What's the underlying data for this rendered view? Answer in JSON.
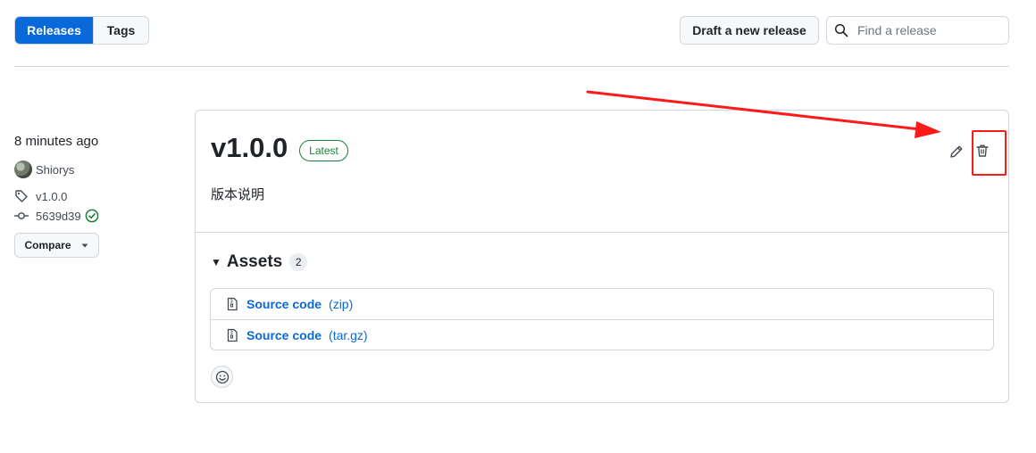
{
  "nav": {
    "tabs": [
      {
        "label": "Releases",
        "active": true
      },
      {
        "label": "Tags",
        "active": false
      }
    ],
    "draft_label": "Draft a new release",
    "search_placeholder": "Find a release"
  },
  "release_meta": {
    "time": "8 minutes ago",
    "author": "Shiorys",
    "tag": "v1.0.0",
    "commit": "5639d39",
    "compare_label": "Compare"
  },
  "release": {
    "title": "v1.0.0",
    "badge": "Latest",
    "notes": "版本说明",
    "assets_label": "Assets",
    "assets_count": "2",
    "assets": [
      {
        "label": "Source code",
        "ext": "(zip)"
      },
      {
        "label": "Source code",
        "ext": "(tar.gz)"
      }
    ]
  },
  "colors": {
    "primary": "#0969da",
    "success": "#1a7f37",
    "annotation": "#ff1a1a",
    "border": "#d0d7de"
  },
  "icons": [
    "search-icon",
    "tag-icon",
    "commit-icon",
    "verified-icon",
    "caret-down-icon",
    "pencil-icon",
    "trash-icon",
    "file-zip-icon",
    "smiley-icon"
  ]
}
